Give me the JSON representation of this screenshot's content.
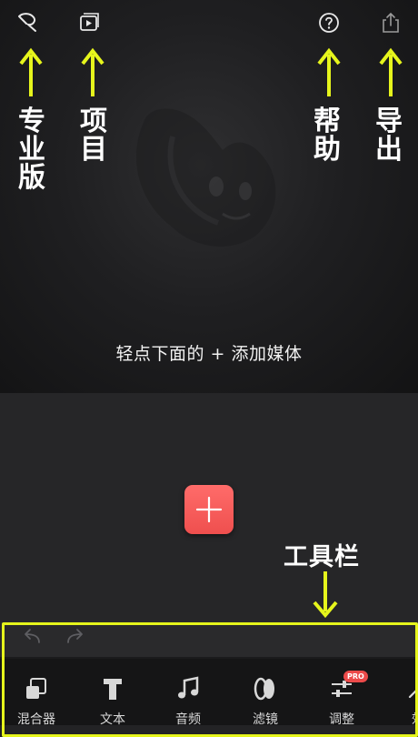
{
  "top_bar": {
    "pro_label": "专业版",
    "projects_label": "项目",
    "help_label": "帮助",
    "export_label": "导出"
  },
  "preview": {
    "hint": "轻点下面的 + 添加媒体"
  },
  "annotation": {
    "toolbar_label": "工具栏",
    "arrow_color": "#e6f51c"
  },
  "toolbar": {
    "pro_badge": "PRO",
    "tools": [
      {
        "label": "混合器",
        "icon": "mixer-icon"
      },
      {
        "label": "文本",
        "icon": "text-icon"
      },
      {
        "label": "音频",
        "icon": "music-note-icon"
      },
      {
        "label": "滤镜",
        "icon": "filter-icon"
      },
      {
        "label": "调整",
        "icon": "adjust-sliders-icon"
      },
      {
        "label": "效",
        "icon": "effects-icon"
      }
    ]
  },
  "colors": {
    "accent": "#ef5554",
    "highlight": "#e6f51c"
  }
}
